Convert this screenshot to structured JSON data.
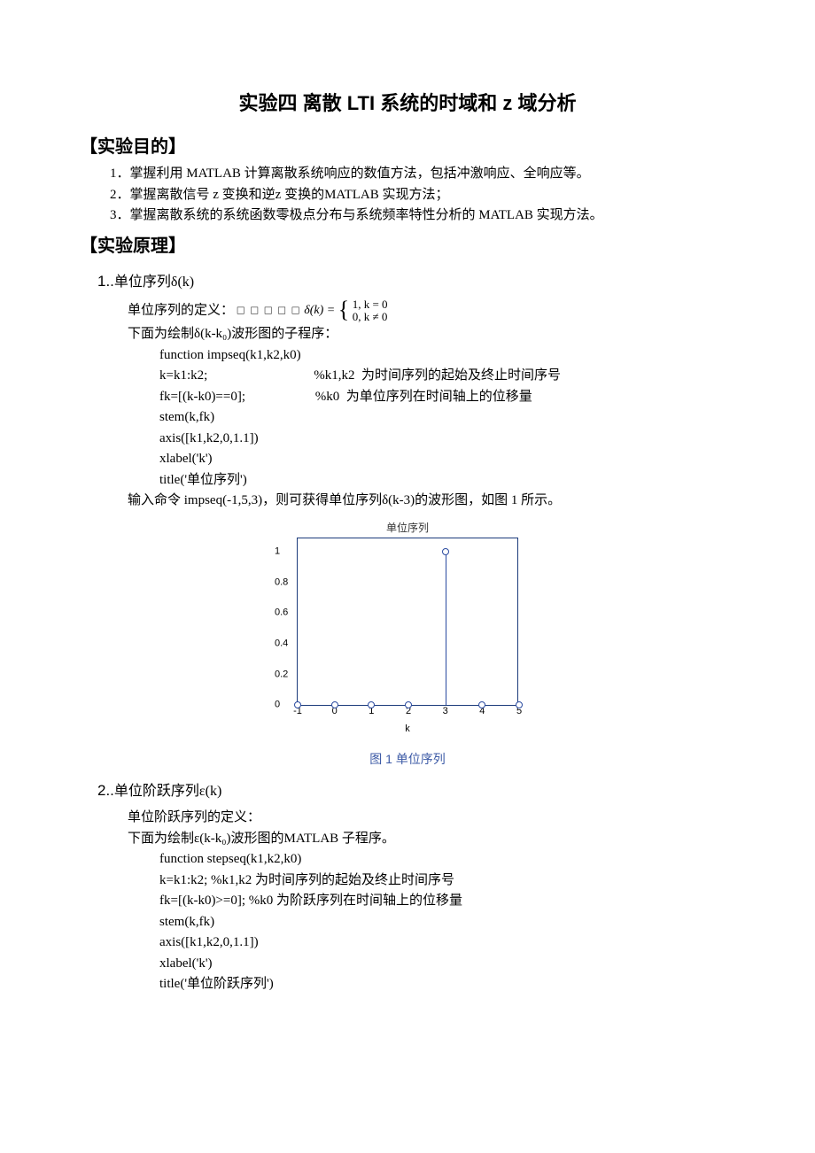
{
  "title": "实验四  离散  LTI  系统的时域和 z  域分析",
  "sections": {
    "objective_head": "【实验目的】",
    "objectives": [
      "1．掌握利用 MATLAB 计算离散系统响应的数值方法，包括冲激响应、全响应等。",
      "2．掌握离散信号 z 变换和逆z 变换的MATLAB 实现方法；",
      "3．掌握离散系统的系统函数零极点分布与系统频率特性分析的 MATLAB 实现方法。"
    ],
    "principle_head": "【实验原理】"
  },
  "sub1": {
    "num": "1..",
    "label": "单位序列δ(k)",
    "def_prefix": "单位序列的定义：",
    "squares": "□ □ □ □ □",
    "formula_lhs": "δ(k) =",
    "case1": "1,  k = 0",
    "case2": "0,  k ≠ 0",
    "line2": "下面为绘制δ(k-k₀)波形图的子程序：",
    "code": [
      "function impseq(k1,k2,k0)",
      "k=k1:k2;                                %k1,k2  为时间序列的起始及终止时间序号",
      "fk=[(k-k0)==0];                     %k0  为单位序列在时间轴上的位移量",
      "stem(k,fk)",
      "axis([k1,k2,0,1.1])",
      "xlabel('k')",
      "title('单位序列')"
    ],
    "after": "输入命令 impseq(-1,5,3)，则可获得单位序列δ(k-3)的波形图，如图 1 所示。"
  },
  "sub2": {
    "num": "2..",
    "label": "单位阶跃序列ε(k)",
    "line1": "单位阶跃序列的定义：",
    "line2": "下面为绘制ε(k-k₀)波形图的MATLAB  子程序。",
    "code": [
      "function stepseq(k1,k2,k0)",
      "k=k1:k2; %k1,k2  为时间序列的起始及终止时间序号",
      "fk=[(k-k0)>=0]; %k0  为阶跃序列在时间轴上的位移量",
      "stem(k,fk)",
      "axis([k1,k2,0,1.1])",
      "xlabel('k')",
      "title('单位阶跃序列')"
    ]
  },
  "chart": {
    "title_small": "单位序列",
    "xlabel": "k",
    "caption": "图 1  单位序列"
  },
  "chart_data": {
    "type": "stem",
    "title": "单位序列",
    "xlabel": "k",
    "ylabel": "",
    "xlim": [
      -1,
      5
    ],
    "ylim": [
      0,
      1.1
    ],
    "x": [
      -1,
      0,
      1,
      2,
      3,
      4,
      5
    ],
    "y": [
      0,
      0,
      0,
      0,
      1,
      0,
      0
    ],
    "xticks": [
      -1,
      0,
      1,
      2,
      3,
      4,
      5
    ],
    "yticks": [
      0,
      0.2,
      0.4,
      0.6,
      0.8,
      1
    ]
  }
}
